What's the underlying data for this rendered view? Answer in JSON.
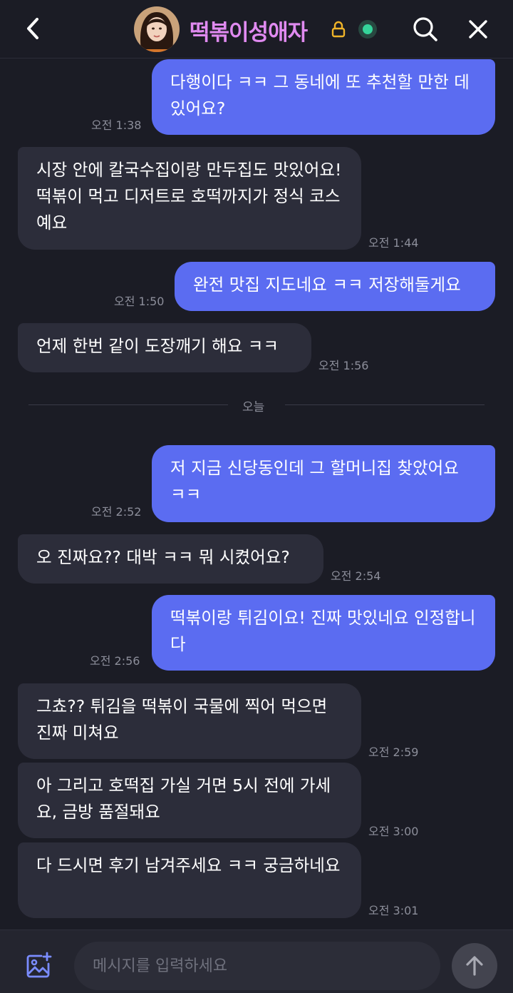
{
  "header": {
    "title": "떡볶이성애자"
  },
  "messages": [
    {
      "text": "다행이다 ㅋㅋ 그 동네에 또 추천할 만한 데 있어요?",
      "time": "오전 1:38"
    },
    {
      "text": "시장 안에 칼국수집이랑 만두집도 맛있어요! 떡볶이 먹고 디저트로 호떡까지가 정식 코스예요",
      "time": "오전 1:44"
    },
    {
      "text": "완전 맛집 지도네요 ㅋㅋ 저장해둘게요",
      "time": "오전 1:50"
    },
    {
      "text": "언제 한번 같이 도장깨기 해요 ㅋㅋ",
      "time": "오전 1:56"
    },
    {
      "text": "저 지금 신당동인데 그 할머니집 찾았어요 ㅋㅋ",
      "time": "오전 2:52"
    },
    {
      "text": "오 진짜요?? 대박 ㅋㅋ 뭐 시켰어요?",
      "time": "오전 2:54"
    },
    {
      "text": "떡볶이랑 튀김이요! 진짜 맛있네요 인정합니다",
      "time": "오전 2:56"
    },
    {
      "text": "그쵸?? 튀김을 떡볶이 국물에 찍어 먹으면 진짜 미쳐요",
      "time": "오전 2:59"
    },
    {
      "text": "아 그리고 호떡집 가실 거면 5시 전에 가세요, 금방 품절돼요",
      "time": "오전 3:00"
    },
    {
      "text": "다 드시면 후기 남겨주세요 ㅋㅋ 궁금하네요",
      "time": "오전 3:01"
    }
  ],
  "divider": {
    "label": "오늘"
  },
  "composer": {
    "placeholder": "메시지를 입력하세요"
  },
  "colors": {
    "background": "#1b1c25",
    "sent_bubble": "#5b6cf1",
    "received_bubble": "#2c2d3a",
    "title": "#e08af0",
    "online": "#35d49a"
  },
  "icons": [
    "back-arrow-icon",
    "lock-icon",
    "online-status-icon",
    "search-icon",
    "close-icon",
    "add-photo-icon",
    "send-arrow-icon"
  ]
}
